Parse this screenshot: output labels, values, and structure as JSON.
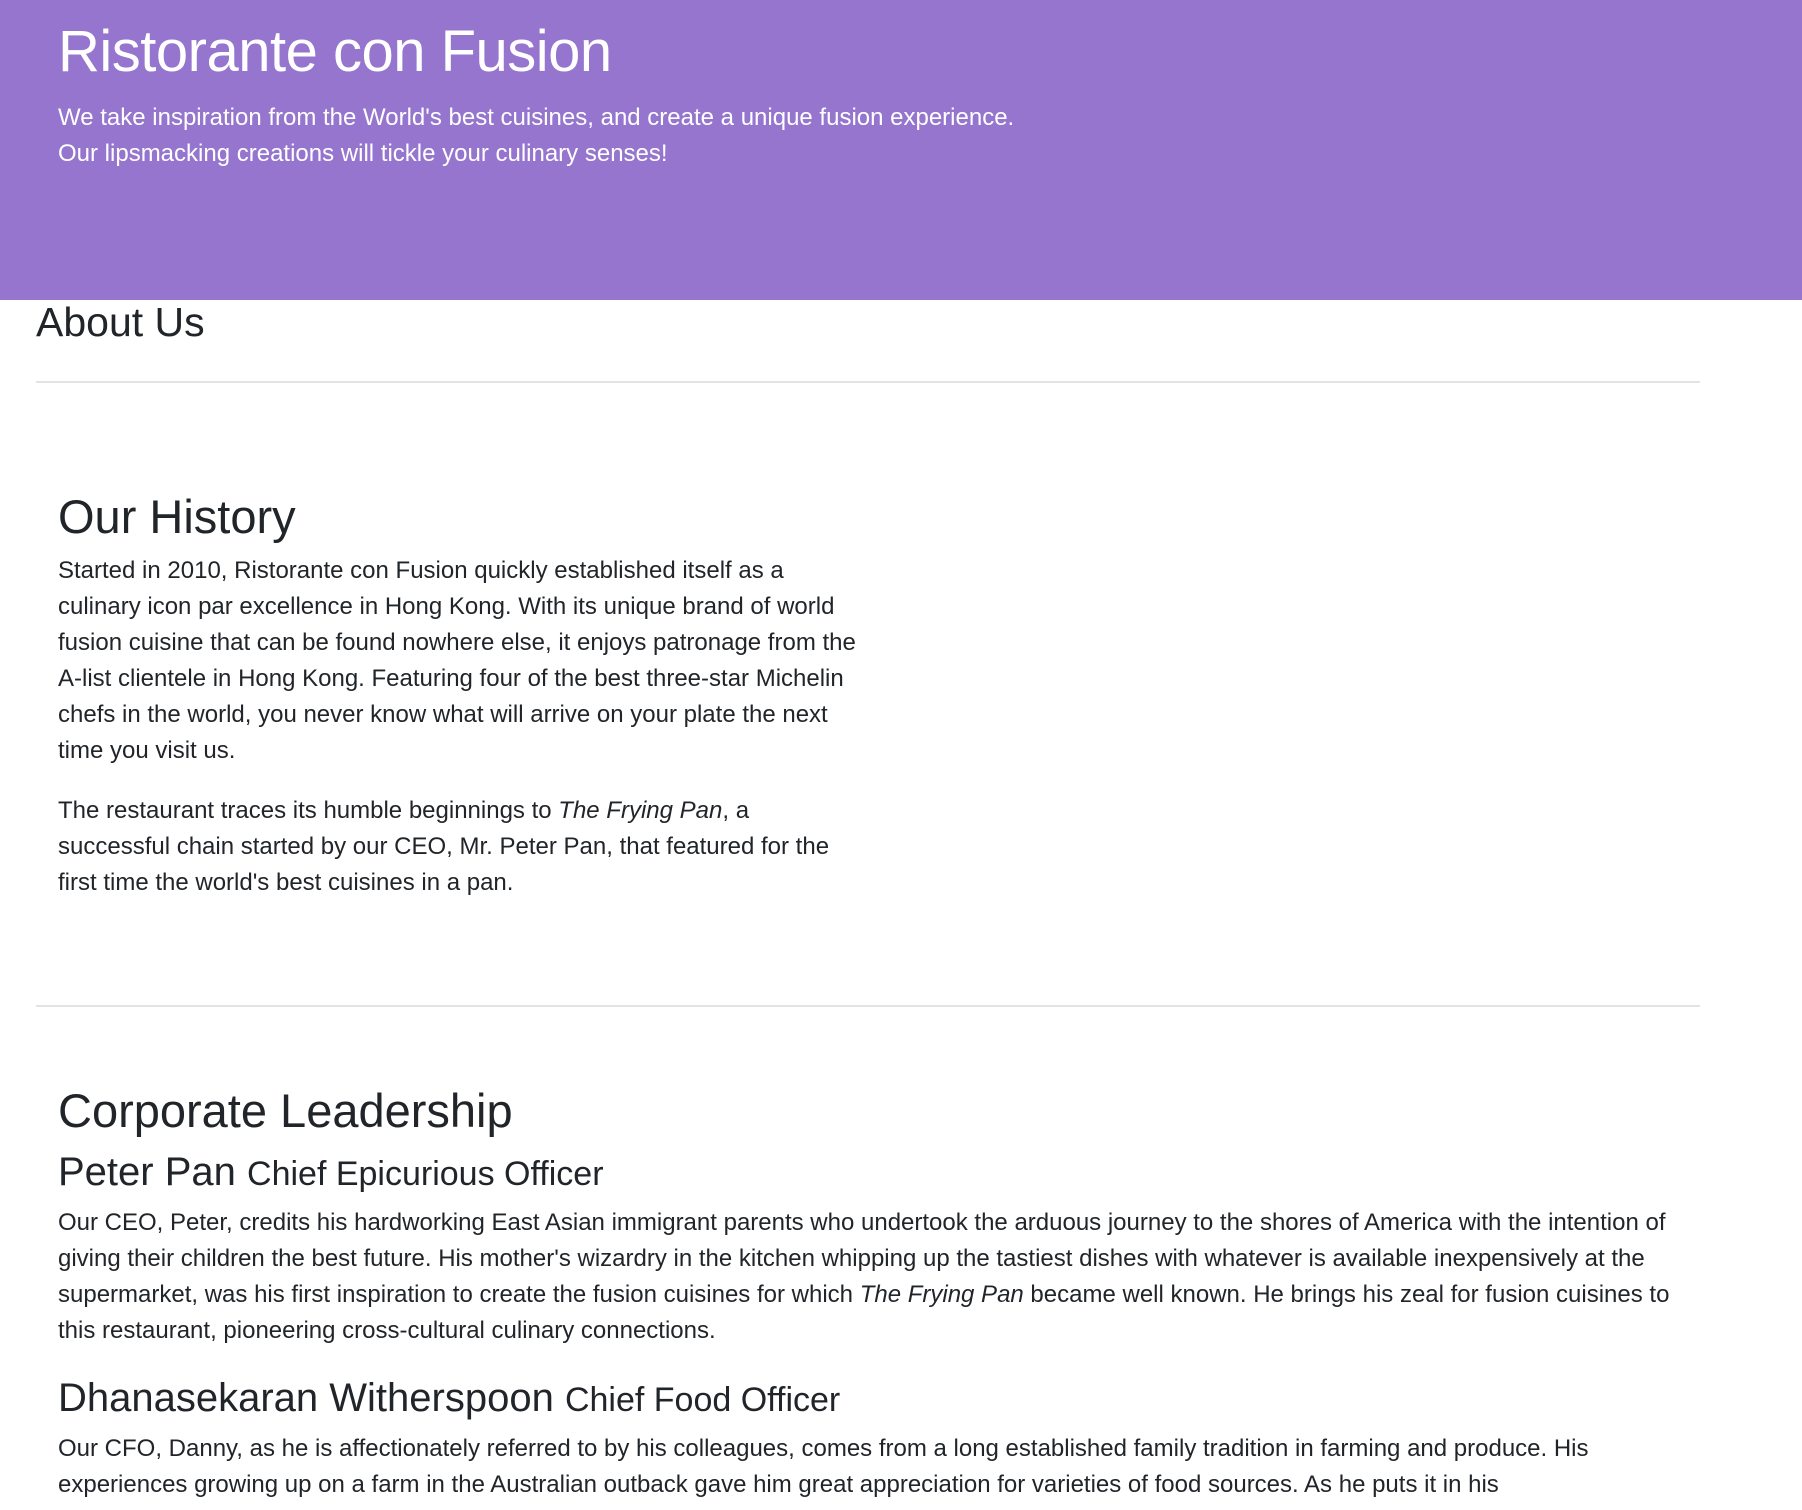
{
  "header": {
    "title": "Ristorante con Fusion",
    "tagline_line1": "We take inspiration from the World's best cuisines, and create a unique fusion experience.",
    "tagline_line2": "Our lipsmacking creations will tickle your culinary senses!"
  },
  "about": {
    "heading": "About Us"
  },
  "history": {
    "heading": "Our History",
    "paragraph1": "Started in 2010, Ristorante con Fusion quickly established itself as a culinary icon par excellence in Hong Kong. With its unique brand of world fusion cuisine that can be found nowhere else, it enjoys patronage from the A-list clientele in Hong Kong. Featuring four of the best three-star Michelin chefs in the world, you never know what will arrive on your plate the next time you visit us.",
    "paragraph2_before": "The restaurant traces its humble beginnings to ",
    "paragraph2_em": "The Frying Pan",
    "paragraph2_after": ", a successful chain started by our CEO, Mr. Peter Pan, that featured for the first time the world's best cuisines in a pan."
  },
  "leadership": {
    "heading": "Corporate Leadership",
    "leaders": [
      {
        "name": "Peter Pan",
        "title": "Chief Epicurious Officer",
        "bio_before": "Our CEO, Peter, credits his hardworking East Asian immigrant parents who undertook the arduous journey to the shores of America with the intention of giving their children the best future. His mother's wizardry in the kitchen whipping up the tastiest dishes with whatever is available inexpensively at the supermarket, was his first inspiration to create the fusion cuisines for which ",
        "bio_em": "The Frying Pan",
        "bio_after": " became well known. He brings his zeal for fusion cuisines to this restaurant, pioneering cross-cultural culinary connections."
      },
      {
        "name": "Dhanasekaran Witherspoon",
        "title": "Chief Food Officer",
        "bio": "Our CFO, Danny, as he is affectionately referred to by his colleagues, comes from a long established family tradition in farming and produce. His experiences growing up on a farm in the Australian outback gave him great appreciation for varieties of food sources. As he puts it in his"
      }
    ]
  },
  "colors": {
    "header_background": "#9575cd",
    "header_text": "#ffffff",
    "body_text": "#212529",
    "divider": "#e3e3e3"
  }
}
